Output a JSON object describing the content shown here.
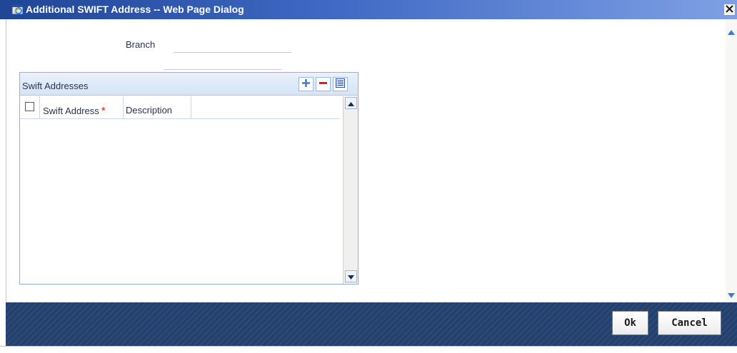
{
  "window": {
    "title": "Additional SWIFT Address -- Web Page Dialog"
  },
  "form": {
    "branch_label": "Branch",
    "branch_value": ""
  },
  "grid": {
    "title": "Swift Addresses",
    "columns": [
      {
        "label": "Swift Address",
        "required": "*"
      },
      {
        "label": "Description"
      }
    ],
    "rows": []
  },
  "footer": {
    "ok_label": "Ok",
    "cancel_label": "Cancel"
  },
  "colors": {
    "titlebar": "#3f69c4",
    "footer": "#24406e",
    "required": "#e21b1b",
    "add": "#3d7de0",
    "remove": "#e21b1b"
  }
}
